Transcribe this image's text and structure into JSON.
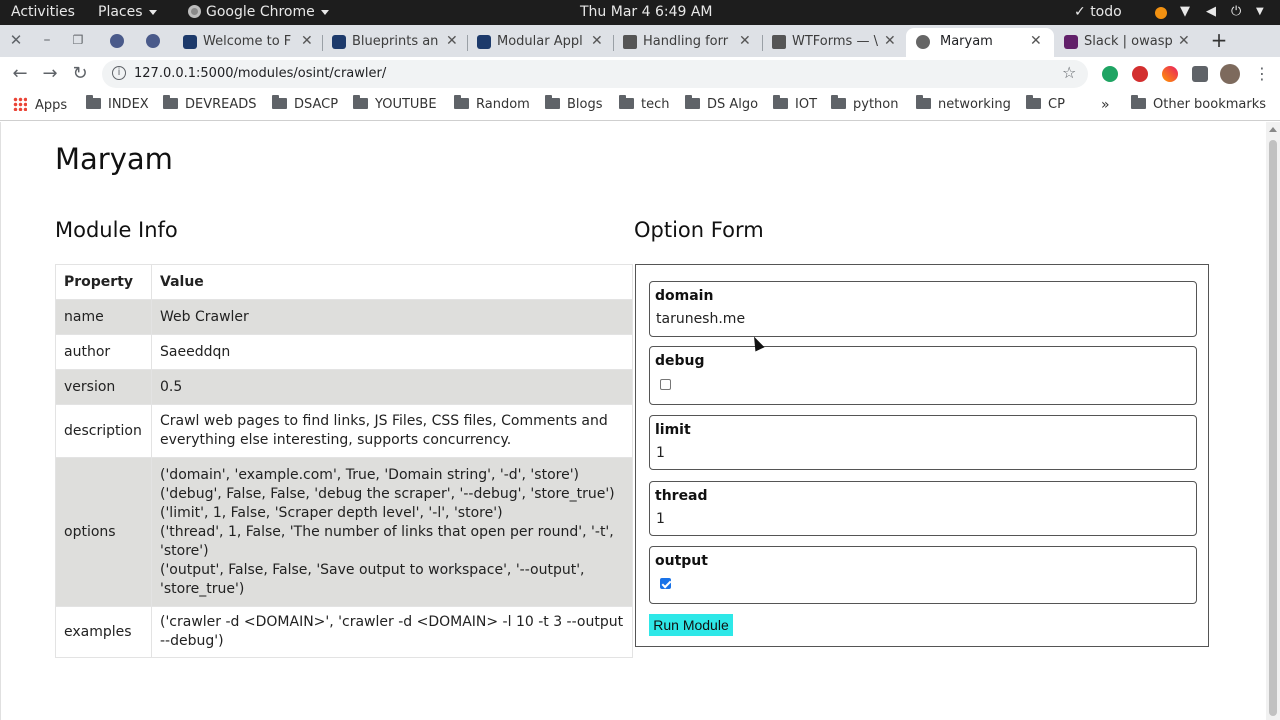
{
  "topbar": {
    "activities": "Activities",
    "places": "Places",
    "app": "Google Chrome",
    "datetime": "Thu Mar 4   6:49 AM",
    "todo": "todo"
  },
  "tabs": [
    {
      "label": "Welcome to F",
      "favicon": "flask-icon"
    },
    {
      "label": "Blueprints an",
      "favicon": "flask-icon"
    },
    {
      "label": "Modular Appl",
      "favicon": "flask-icon"
    },
    {
      "label": "Handling forr",
      "favicon": "doc-icon"
    },
    {
      "label": "WTForms — \\",
      "favicon": "doc-icon"
    },
    {
      "label": "Maryam",
      "favicon": "globe-icon",
      "active": true
    },
    {
      "label": "Slack | owasp",
      "favicon": "slack-icon"
    }
  ],
  "address": {
    "url": "127.0.0.1:5000/modules/osint/crawler/"
  },
  "bookmarks": [
    "Apps",
    "INDEX",
    "DEVREADS",
    "DSACP",
    "YOUTUBE",
    "Random",
    "Blogs",
    "tech",
    "DS Algo",
    "IOT",
    "python",
    "networking",
    "CP",
    "Other bookmarks"
  ],
  "page": {
    "title": "Maryam",
    "module_info_heading": "Module Info",
    "option_form_heading": "Option Form",
    "table": {
      "headers": [
        "Property",
        "Value"
      ],
      "rows": [
        {
          "key": "name",
          "value": "Web Crawler"
        },
        {
          "key": "author",
          "value": "Saeeddqn"
        },
        {
          "key": "version",
          "value": "0.5"
        },
        {
          "key": "description",
          "value": "Crawl web pages to find links, JS Files, CSS files, Comments and everything else interesting, supports concurrency."
        },
        {
          "key": "options",
          "lines": [
            "('domain', 'example.com', True, 'Domain string', '-d', 'store')",
            "('debug', False, False, 'debug the scraper', '--debug', 'store_true')",
            "('limit', 1, False, 'Scraper depth level', '-l', 'store')",
            "('thread', 1, False, 'The number of links that open per round', '-t', 'store')",
            "('output', False, False, 'Save output to workspace', '--output', 'store_true')"
          ]
        },
        {
          "key": "examples",
          "value": "('crawler -d <DOMAIN>', 'crawler -d <DOMAIN> -l 10 -t 3 --output --debug')"
        }
      ]
    },
    "form": {
      "domain": {
        "label": "domain",
        "value": "tarunesh.me"
      },
      "debug": {
        "label": "debug",
        "checked": false
      },
      "limit": {
        "label": "limit",
        "value": "1"
      },
      "thread": {
        "label": "thread",
        "value": "1"
      },
      "output": {
        "label": "output",
        "checked": true
      },
      "run_label": "Run Module"
    }
  }
}
